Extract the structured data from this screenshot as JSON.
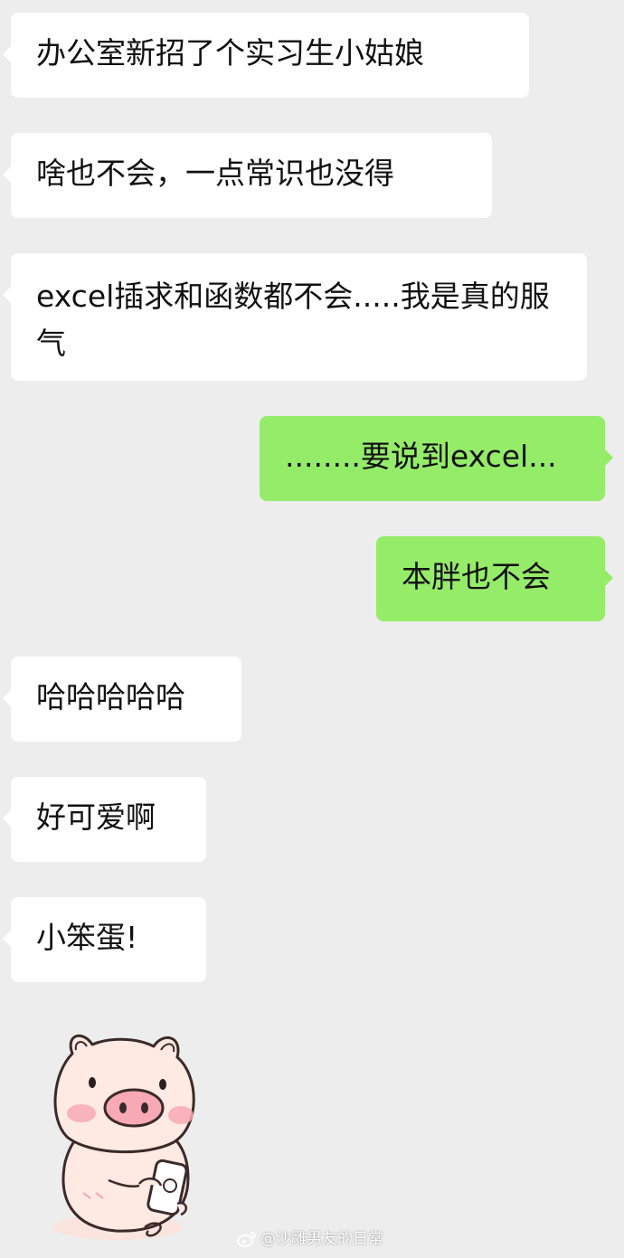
{
  "messages": [
    {
      "side": "in",
      "text": "办公室新招了个实习生小姑娘"
    },
    {
      "side": "in",
      "text": "啥也不会，一点常识也没得"
    },
    {
      "side": "in",
      "text": "excel插求和函数都不会.....我是真的服气"
    },
    {
      "side": "out",
      "text": "........要说到excel..."
    },
    {
      "side": "out",
      "text": "本胖也不会"
    },
    {
      "side": "in",
      "text": "哈哈哈哈哈"
    },
    {
      "side": "in",
      "text": "好可爱啊"
    },
    {
      "side": "in",
      "text": "小笨蛋!"
    }
  ],
  "sticker": {
    "icon": "pig-sticker-icon"
  },
  "watermark": {
    "text": "@沙雕男友的日常",
    "icon": "weibo-icon"
  },
  "colors": {
    "background": "#ededed",
    "incoming_bubble": "#ffffff",
    "outgoing_bubble": "#95ec69",
    "text": "#111111"
  }
}
